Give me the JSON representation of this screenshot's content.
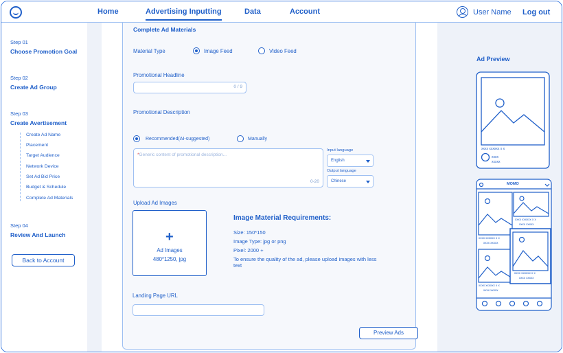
{
  "nav": {
    "home": "Home",
    "advertising": "Advertising Inputting",
    "data": "Data",
    "account": "Account",
    "user_name": "User Name",
    "logout": "Log out"
  },
  "sidebar": {
    "steps": [
      {
        "no": "Step 01",
        "title": "Choose Promotion Goal"
      },
      {
        "no": "Step 02",
        "title": "Create Ad Group"
      },
      {
        "no": "Step 03",
        "title": "Create Avertisement"
      },
      {
        "no": "Step 04",
        "title": "Review And Launch"
      }
    ],
    "substeps": [
      "Create Ad Name",
      "Placement",
      "Target Audience",
      "Network Device",
      "Set Ad Bid Price",
      "Budget & Schedule",
      "Complete Ad Materials"
    ],
    "back_button": "Back to Account"
  },
  "form": {
    "section_title": "Complete Ad Materials",
    "material_type_label": "Material Type",
    "image_feed": "Image Feed",
    "video_feed": "Video Feed",
    "headline_label": "Promotional Headline",
    "headline_count": "0 / 9",
    "description_label": "Promotional  Description",
    "recommended": "Recommended(AI-suggested)",
    "manually": "Manually",
    "description_placeholder": "Generic content of promotional description...",
    "description_count": "0-20",
    "input_language_label": "Input language",
    "input_language": "English",
    "output_language_label": "Output language",
    "output_language": "Chinese",
    "upload_label": "Upload Ad Images",
    "upload_box_title": "Ad Images",
    "upload_box_size": "480*1250, jpg",
    "requirements_title": "Image Material Requirements:",
    "req_size": "Size: 150*150",
    "req_type": "Image Type: jpg or png",
    "req_pixel": "Pixel: 2000 +",
    "req_note": "To ensure the quality of the ad, please upload images with less text",
    "landing_label": "Landing Page URL",
    "preview_button": "Preview Ads"
  },
  "preview": {
    "title": "Ad Preview",
    "card_caption": "xxxx xxxxxx x x",
    "card_sub1": "xxxx",
    "card_sub2": "xxxxx",
    "feed_title": "MOMO",
    "feed_caption": "xxxx xxxxxx x x",
    "feed_sub": "xxxx xxxxx"
  },
  "colors": {
    "primary": "#1f5fc9",
    "border": "#9ec0f2",
    "panel_bg": "#eef2f9"
  }
}
